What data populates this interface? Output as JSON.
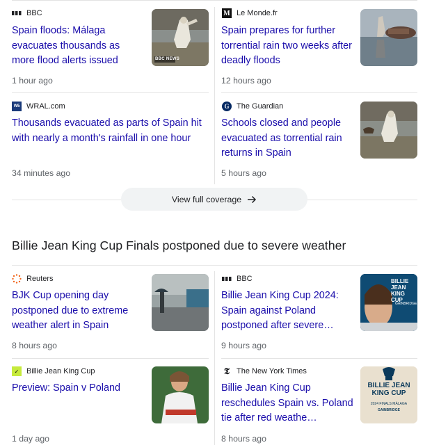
{
  "cluster1": {
    "articles": [
      {
        "source": "BBC",
        "headline": "Spain floods: Málaga evacuates thousands as more flood alerts issued",
        "time": "1 hour ago",
        "logo_icon": "bbc-logo-icon",
        "thumb_label": "BBC NEWS"
      },
      {
        "source": "Le Monde.fr",
        "headline": "Spain prepares for further torrential rain two weeks after deadly floods",
        "time": "12 hours ago",
        "logo_icon": "le-monde-logo-icon"
      },
      {
        "source": "WRAL.com",
        "headline": "Thousands evacuated as parts of Spain hit with nearly a month's rainfall in one hour",
        "time": "34 minutes ago",
        "logo_icon": "wral-logo-icon"
      },
      {
        "source": "The Guardian",
        "headline": "Schools closed and people evacuated as torrential rain returns in Spain",
        "time": "5 hours ago",
        "logo_icon": "guardian-logo-icon"
      }
    ],
    "view_full_coverage": "View full coverage"
  },
  "cluster2": {
    "title": "Billie Jean King Cup Finals postponed due to severe weather",
    "articles": [
      {
        "source": "Reuters",
        "headline": "BJK Cup opening day postponed due to extreme weather alert in Spain",
        "time": "8 hours ago",
        "logo_icon": "reuters-logo-icon"
      },
      {
        "source": "BBC",
        "headline": "Billie Jean King Cup 2024: Spain against Poland postponed after severe…",
        "time": "9 hours ago",
        "logo_icon": "bbc-logo-icon",
        "thumb_text": "BILLIE JEAN KING CUP",
        "thumb_sub": "GAINBRIDGE"
      },
      {
        "source": "Billie Jean King Cup",
        "headline": "Preview: Spain v Poland",
        "time": "1 day ago",
        "logo_icon": "bjk-cup-logo-icon"
      },
      {
        "source": "The New York Times",
        "headline": "Billie Jean King Cup reschedules Spain vs. Poland tie after red weathe…",
        "time": "8 hours ago",
        "logo_icon": "nyt-logo-icon",
        "thumb_text": "BILLIE JEAN KING CUP",
        "thumb_sub": "2024 FINALS MÁLAGA",
        "thumb_sub2": "GAINBRIDGE"
      }
    ]
  }
}
